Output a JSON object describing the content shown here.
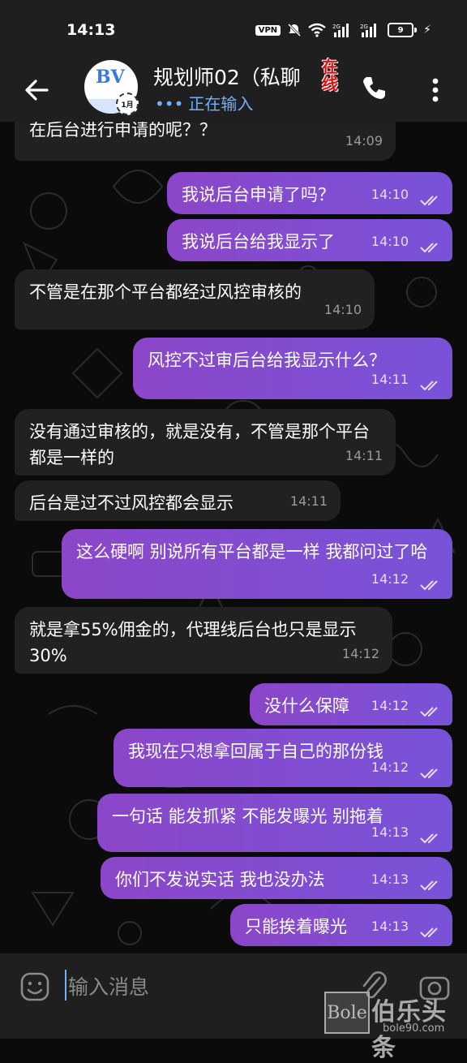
{
  "status_bar": {
    "time": "14:13",
    "vpn_label": "VPN",
    "battery_level": "9",
    "icons": [
      "mute-icon",
      "wifi-icon",
      "signal-icon",
      "signal-icon",
      "battery-icon",
      "charging-icon"
    ]
  },
  "header": {
    "title": "规划师02（私聊",
    "online_stamp": "在线",
    "typing_status": "正在输入",
    "avatar_badge": "1月",
    "avatar_logo": "BV"
  },
  "messages": [
    {
      "dir": "in",
      "text": "在后台进行申请的呢？？",
      "time": "14:09"
    },
    {
      "dir": "out",
      "text": "我说后台申请了吗？",
      "time": "14:10",
      "read": true
    },
    {
      "dir": "out",
      "text": "我说后台给我显示了",
      "time": "14:10",
      "read": true
    },
    {
      "dir": "in",
      "text": "不管是在那个平台都经过风控审核的",
      "time": "14:10"
    },
    {
      "dir": "out",
      "text": "风控不过审后台给我显示什么？",
      "time": "14:11",
      "read": true
    },
    {
      "dir": "in",
      "text": "没有通过审核的，就是没有，不管是那个平台都是一样的",
      "time": "14:11"
    },
    {
      "dir": "in",
      "text": "后台是过不过风控都会显示",
      "time": "14:11"
    },
    {
      "dir": "out",
      "text": "这么硬啊 别说所有平台都是一样 我都问过了哈",
      "time": "14:12",
      "read": true
    },
    {
      "dir": "in",
      "text": "就是拿55%佣金的，代理线后台也只是显示30%",
      "time": "14:12"
    },
    {
      "dir": "out",
      "text": "没什么保障",
      "time": "14:12",
      "read": true
    },
    {
      "dir": "out",
      "text": "我现在只想拿回属于自己的那份钱",
      "time": "14:12",
      "read": true
    },
    {
      "dir": "out",
      "text": "一句话 能发抓紧 不能发曝光 别拖着",
      "time": "14:13",
      "read": true
    },
    {
      "dir": "out",
      "text": "你们不发说实话 我也没办法",
      "time": "14:13",
      "read": true
    },
    {
      "dir": "out",
      "text": "只能挨着曝光",
      "time": "14:13",
      "read": true
    }
  ],
  "input": {
    "placeholder": "输入消息"
  },
  "watermark": {
    "logo_text": "Bole",
    "name": "伯乐头条",
    "url": "bole90.com"
  },
  "colors": {
    "incoming_bubble": "#212121",
    "outgoing_bubble_start": "#8c46c9",
    "outgoing_bubble_end": "#7853d8",
    "typing_accent": "#6fb0ff",
    "bar_bg": "#1f1f1f",
    "chat_bg": "#0b0b0b"
  }
}
